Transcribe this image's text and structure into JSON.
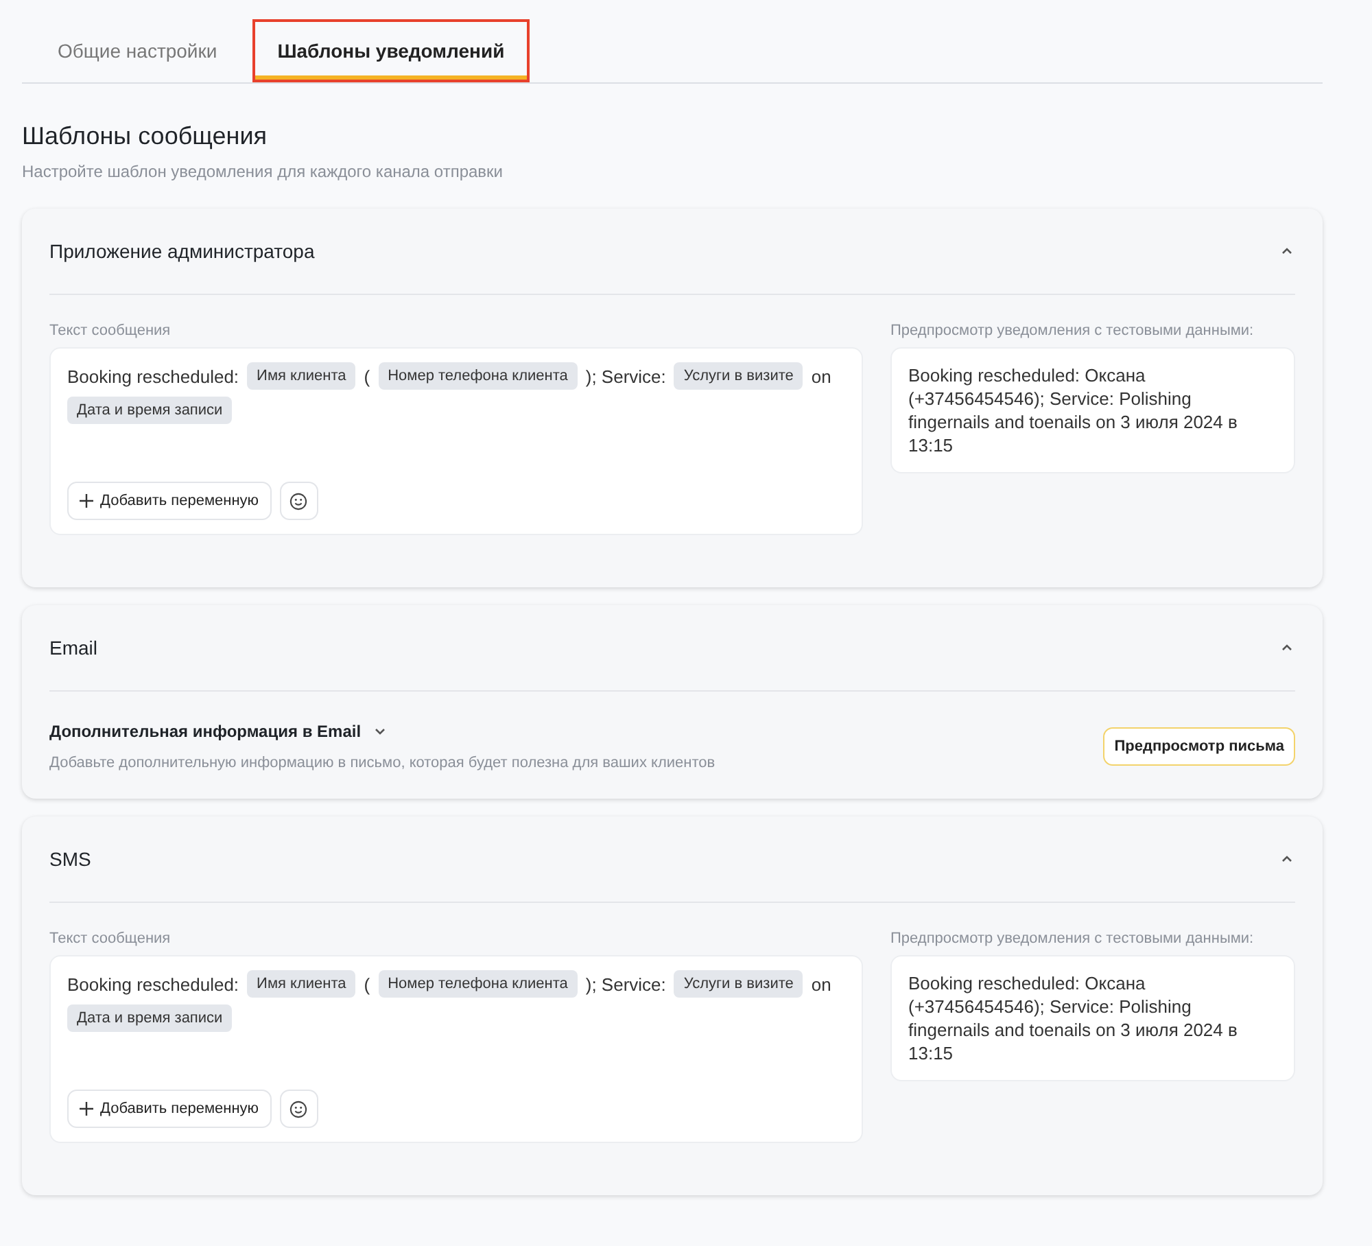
{
  "tabs": [
    {
      "label": "Общие настройки",
      "selected": false
    },
    {
      "label": "Шаблоны уведомлений",
      "selected": true
    }
  ],
  "heading": "Шаблоны сообщения",
  "subheading": "Настройте шаблон уведомления для каждого канала отправки",
  "sections": [
    {
      "kind": "template",
      "title": "Приложение администратора",
      "expanded": true,
      "message_label": "Текст сообщения",
      "parts": [
        {
          "kind": "text",
          "text": "Booking rescheduled:"
        },
        {
          "kind": "chip",
          "text": "Имя клиента"
        },
        {
          "kind": "text",
          "text": "("
        },
        {
          "kind": "chip",
          "text": "Номер телефона клиента"
        },
        {
          "kind": "text",
          "text": "); Service:"
        },
        {
          "kind": "chip",
          "text": "Услуги в визите"
        },
        {
          "kind": "text",
          "text": "on"
        },
        {
          "kind": "chip",
          "text": "Дата и время записи"
        }
      ],
      "add_button": "Добавить переменную",
      "preview_label": "Предпросмотр уведомления с тестовыми данными:",
      "preview_text": "Booking rescheduled: Оксана (+37456454546); Service: Polishing fingernails and toenails on 3 июля 2024 в 13:15"
    },
    {
      "kind": "email",
      "title": "Email",
      "expanded": true,
      "info_title": "Дополнительная информация в Email",
      "info_description": "Добавьте дополнительную информацию в письмо, которая будет полезна для ваших клиентов",
      "preview_button": "Предпросмотр письма"
    },
    {
      "kind": "template",
      "title": "SMS",
      "expanded": true,
      "message_label": "Текст сообщения",
      "parts": [
        {
          "kind": "text",
          "text": "Booking rescheduled:"
        },
        {
          "kind": "chip",
          "text": "Имя клиента"
        },
        {
          "kind": "text",
          "text": "("
        },
        {
          "kind": "chip",
          "text": "Номер телефона клиента"
        },
        {
          "kind": "text",
          "text": "); Service:"
        },
        {
          "kind": "chip",
          "text": "Услуги в визите"
        },
        {
          "kind": "text",
          "text": "on"
        },
        {
          "kind": "chip",
          "text": "Дата и время записи"
        }
      ],
      "add_button": "Добавить переменную",
      "preview_label": "Предпросмотр уведомления с тестовыми данными:",
      "preview_text": "Booking rescheduled: Оксана (+37456454546); Service: Polishing fingernails and toenails on 3 июля 2024 в 13:15"
    }
  ]
}
